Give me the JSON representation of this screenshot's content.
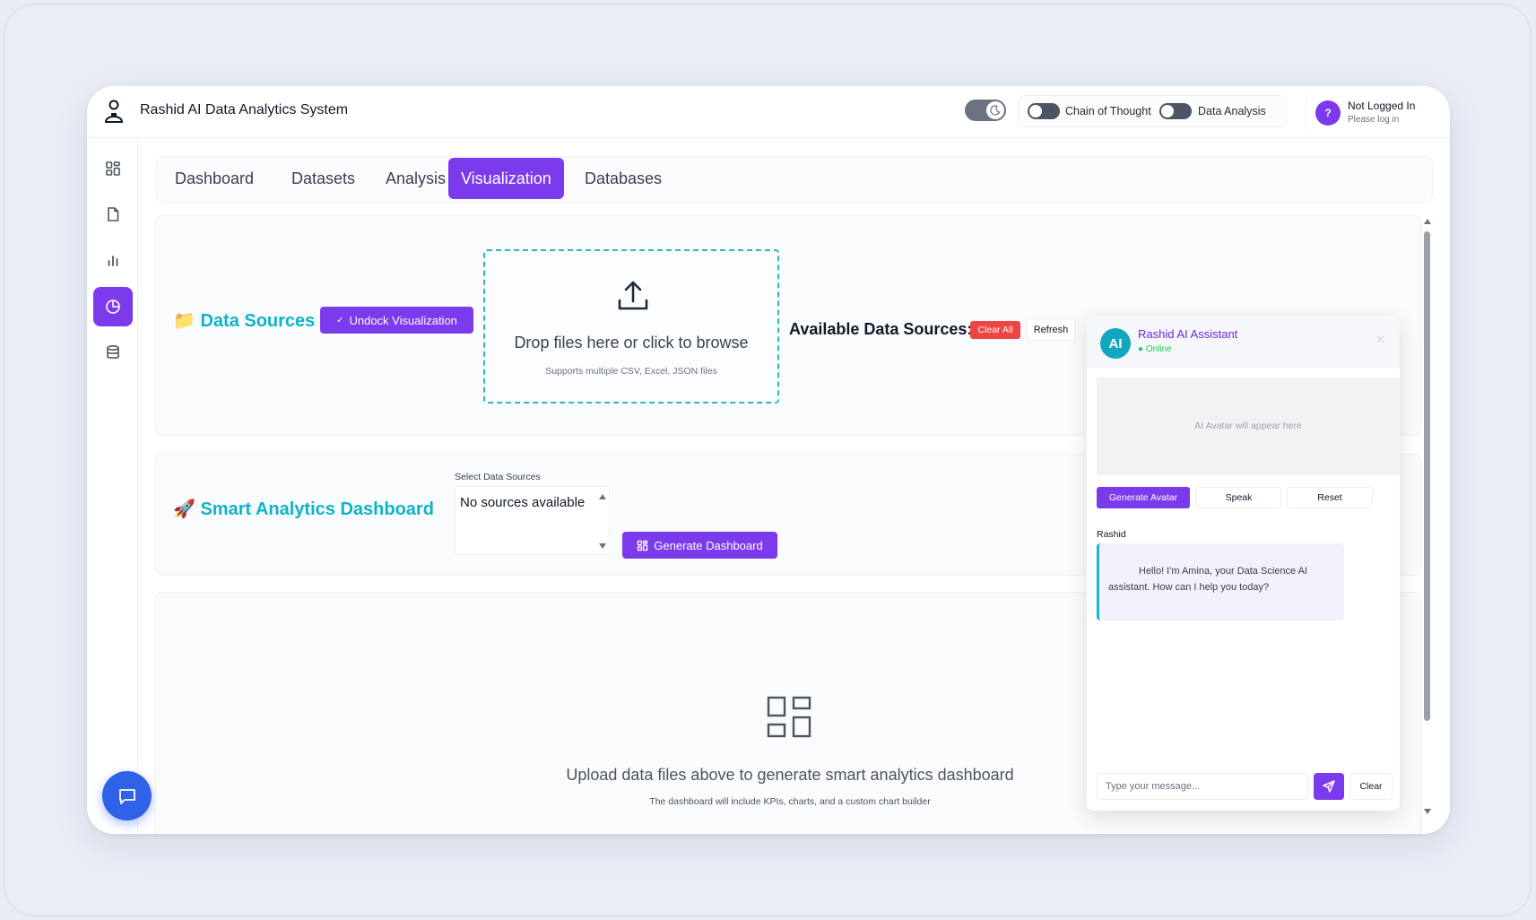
{
  "app": {
    "title": "Rashid AI Data Analytics System"
  },
  "header": {
    "toggles": [
      {
        "label": "Chain of Thought"
      },
      {
        "label": "Data Analysis"
      }
    ],
    "user": {
      "avatar_glyph": "?",
      "name": "Not Logged In",
      "subtitle": "Please log in"
    }
  },
  "sidebar": {
    "items": [
      {
        "icon": "grid-icon"
      },
      {
        "icon": "document-icon"
      },
      {
        "icon": "bar-chart-icon"
      },
      {
        "icon": "pie-chart-icon",
        "active": true
      },
      {
        "icon": "database-icon"
      }
    ],
    "chat_button_icon": "chat-bubble-icon"
  },
  "tabs": [
    {
      "label": "Dashboard"
    },
    {
      "label": "Datasets"
    },
    {
      "label": "Analysis"
    },
    {
      "label": "Visualization",
      "active": true
    },
    {
      "label": "Databases"
    }
  ],
  "data_sources": {
    "icon": "📁",
    "title": "Data Sources",
    "undock_label": "Undock Visualization",
    "undock_icon": "✓",
    "dropzone": {
      "main": "Drop files here or click to browse",
      "sub": "Supports multiple CSV, Excel, JSON files"
    },
    "available_label": "Available Data Sources:",
    "clear_all_label": "Clear All",
    "refresh_label": "Refresh"
  },
  "smart_dashboard": {
    "icon": "🚀",
    "title": "Smart Analytics Dashboard",
    "select_label": "Select Data Sources",
    "select_empty": "No sources available",
    "generate_label": "Generate Dashboard"
  },
  "empty_state": {
    "main": "Upload data files above to generate smart analytics dashboard",
    "sub": "The dashboard will include KPIs, charts, and a custom chart builder"
  },
  "chat": {
    "avatar_text": "AI",
    "title": "Rashid AI Assistant",
    "status": "● Online",
    "close_glyph": "✕",
    "avatar_placeholder": "AI Avatar will appear here",
    "buttons": {
      "generate": "Generate Avatar",
      "speak": "Speak",
      "reset": "Reset"
    },
    "messages": [
      {
        "sender": "Rashid",
        "text": "Hello! I'm Amina, your Data Science AI assistant. How can I help you today?"
      }
    ],
    "input_placeholder": "Type your message...",
    "clear_label": "Clear"
  },
  "colors": {
    "accent": "#7c3aed",
    "teal": "#0fb3c8",
    "danger": "#ef4444",
    "fab": "#2f62e6"
  }
}
